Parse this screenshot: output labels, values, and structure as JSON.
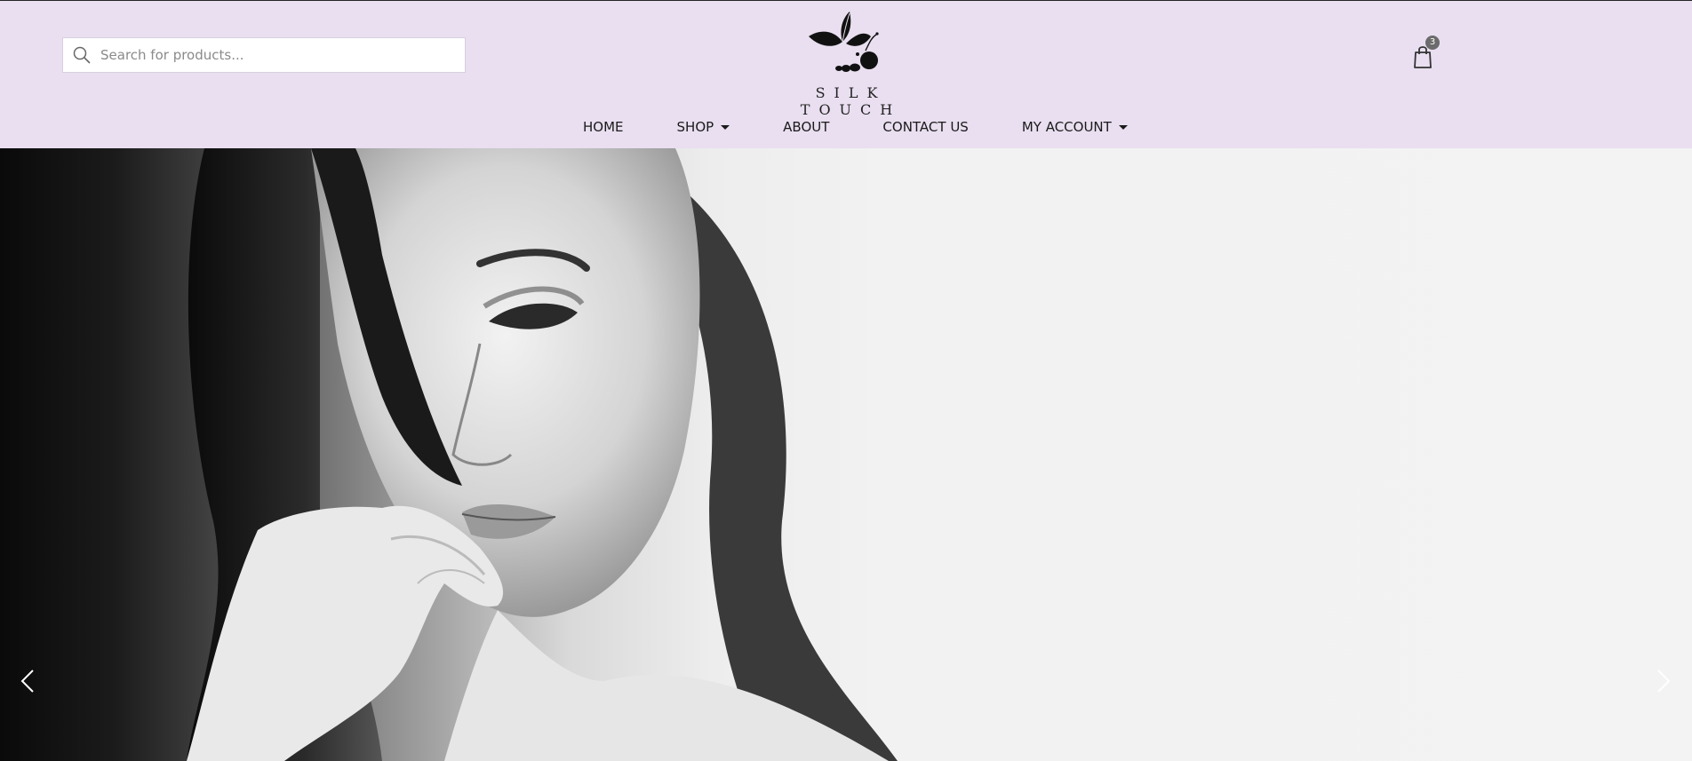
{
  "search": {
    "placeholder": "Search for products..."
  },
  "brand": {
    "name": "SILK TOUCH"
  },
  "cart": {
    "count": "3"
  },
  "nav": {
    "items": [
      {
        "label": "HOME",
        "has_dropdown": false
      },
      {
        "label": "SHOP",
        "has_dropdown": true
      },
      {
        "label": "ABOUT",
        "has_dropdown": false
      },
      {
        "label": "CONTACT US",
        "has_dropdown": false
      },
      {
        "label": "MY ACCOUNT",
        "has_dropdown": true
      }
    ]
  },
  "icons": {
    "search": "search-icon",
    "cart": "shopping-bag-icon",
    "logo": "butterfly-logo",
    "prev": "chevron-left-icon",
    "next": "chevron-right-icon"
  },
  "colors": {
    "header_bg": "#e9dff0",
    "hero_bg": "#f2f2f2",
    "text": "#1a1a1a"
  }
}
